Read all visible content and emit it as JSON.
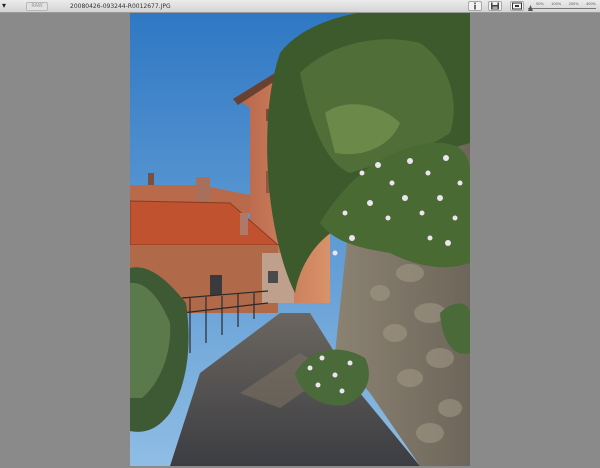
{
  "toolbar": {
    "menu_label": "▾",
    "raw_label": "RAW",
    "file_name": "20080426-093244-R0012677.JPG",
    "info_icon": "info-icon",
    "save_icon": "save-icon",
    "fit_icon": "fit-screen-icon",
    "zoom": {
      "labels": [
        "50%",
        "100%",
        "200%",
        "400%"
      ],
      "value_fraction": 0.0
    }
  },
  "photo": {
    "subject": "village-alley-photo",
    "colors": {
      "sky": "#3d86c9",
      "roof": "#c85a3a",
      "building": "#c87a55",
      "tree": "#3f5a2e",
      "wall": "#8a8070",
      "path": "#4a4c52",
      "flowers": "#e8e0f0"
    }
  }
}
